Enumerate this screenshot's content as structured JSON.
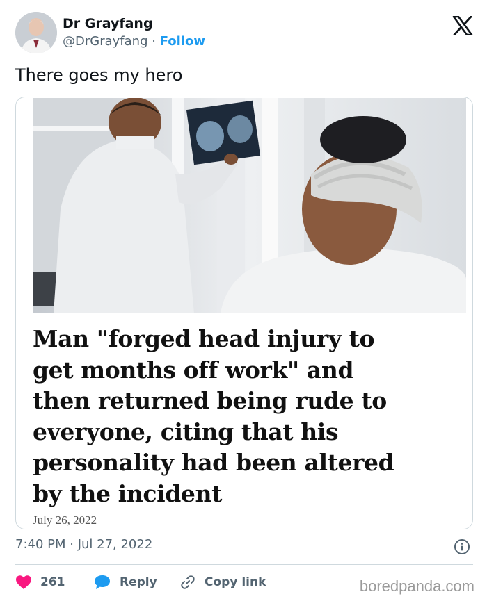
{
  "author": {
    "name": "Dr Grayfang",
    "handle": "@DrGrayfang",
    "separator": "·",
    "follow_label": "Follow"
  },
  "tweet": {
    "text": "There goes my hero"
  },
  "card": {
    "headline_lines": [
      "Man \"forged head injury to",
      "get months off work\" and",
      "then returned being rude to",
      "everyone, citing that his",
      "personality had been altered",
      "by the incident"
    ],
    "date": "July 26, 2022"
  },
  "meta": {
    "timestamp": "7:40 PM · Jul 27, 2022"
  },
  "actions": {
    "like_count": "261",
    "reply_label": "Reply",
    "copy_link_label": "Copy link"
  },
  "watermark": "boredpanda.com",
  "colors": {
    "accent": "#1d9bf0",
    "like": "#f91880",
    "text_secondary": "#536471",
    "border": "#cfd9de"
  },
  "icons": {
    "platform": "x-logo-icon",
    "info": "info-icon",
    "like": "heart-icon",
    "reply": "speech-bubble-icon",
    "copy_link": "link-icon"
  }
}
